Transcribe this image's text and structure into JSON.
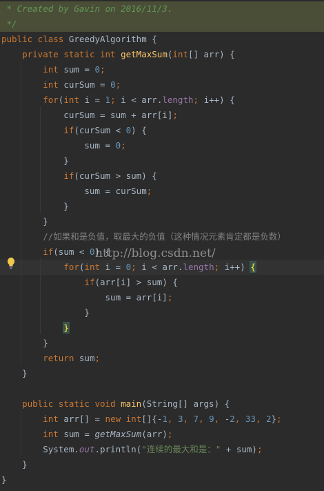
{
  "editor": {
    "lines": [
      [
        [
          "doc",
          " * Created by Gavin on 2016/11/3."
        ]
      ],
      [
        [
          "doc",
          " */"
        ]
      ],
      [
        [
          "kw",
          "public class "
        ],
        [
          "p",
          "GreedyAlgorithm {"
        ]
      ],
      [
        [
          "p",
          "    "
        ],
        [
          "kw",
          "private static int "
        ],
        [
          "fn",
          "getMaxSum"
        ],
        [
          "p",
          "("
        ],
        [
          "kw",
          "int"
        ],
        [
          "p",
          "[] arr) {"
        ]
      ],
      [
        [
          "p",
          "        "
        ],
        [
          "kw",
          "int "
        ],
        [
          "p",
          "sum = "
        ],
        [
          "num",
          "0"
        ],
        [
          "kw",
          ";"
        ]
      ],
      [
        [
          "p",
          "        "
        ],
        [
          "kw",
          "int "
        ],
        [
          "p",
          "curSum = "
        ],
        [
          "num",
          "0"
        ],
        [
          "kw",
          ";"
        ]
      ],
      [
        [
          "p",
          "        "
        ],
        [
          "kw",
          "for"
        ],
        [
          "p",
          "("
        ],
        [
          "kw",
          "int "
        ],
        [
          "p",
          "i = "
        ],
        [
          "num",
          "1"
        ],
        [
          "kw",
          "; "
        ],
        [
          "p",
          "i < arr."
        ],
        [
          "fld",
          "length"
        ],
        [
          "kw",
          "; "
        ],
        [
          "p",
          "i++) {"
        ]
      ],
      [
        [
          "p",
          "            curSum = sum + arr[i]"
        ],
        [
          "kw",
          ";"
        ]
      ],
      [
        [
          "p",
          "            "
        ],
        [
          "kw",
          "if"
        ],
        [
          "p",
          "(curSum < "
        ],
        [
          "num",
          "0"
        ],
        [
          "p",
          ") {"
        ]
      ],
      [
        [
          "p",
          "                sum = "
        ],
        [
          "num",
          "0"
        ],
        [
          "kw",
          ";"
        ]
      ],
      [
        [
          "p",
          "            }"
        ]
      ],
      [
        [
          "p",
          "            "
        ],
        [
          "kw",
          "if"
        ],
        [
          "p",
          "(curSum > sum) {"
        ]
      ],
      [
        [
          "p",
          "                sum = curSum"
        ],
        [
          "kw",
          ";"
        ]
      ],
      [
        [
          "p",
          "            }"
        ]
      ],
      [
        [
          "p",
          "        }"
        ]
      ],
      [
        [
          "p",
          "        "
        ],
        [
          "cm",
          "//如果和是负值，取最大的负值（这种情况元素肯定都是负数）"
        ]
      ],
      [
        [
          "p",
          "        "
        ],
        [
          "kw",
          "if"
        ],
        [
          "p",
          "(sum < "
        ],
        [
          "num",
          "0"
        ],
        [
          "p",
          ") {"
        ]
      ],
      [
        [
          "p",
          "            "
        ],
        [
          "kw",
          "for"
        ],
        [
          "p",
          "("
        ],
        [
          "kw",
          "int "
        ],
        [
          "p",
          "i = "
        ],
        [
          "num",
          "0"
        ],
        [
          "kw",
          "; "
        ],
        [
          "p",
          "i < arr."
        ],
        [
          "fld",
          "length"
        ],
        [
          "kw",
          "; "
        ],
        [
          "p",
          "i++) "
        ],
        [
          "hl",
          "{"
        ]
      ],
      [
        [
          "p",
          "                "
        ],
        [
          "kw",
          "if"
        ],
        [
          "p",
          "(arr[i] > sum) {"
        ]
      ],
      [
        [
          "p",
          "                    sum = arr[i]"
        ],
        [
          "kw",
          ";"
        ]
      ],
      [
        [
          "p",
          "                }"
        ]
      ],
      [
        [
          "p",
          "            "
        ],
        [
          "hl",
          "}"
        ]
      ],
      [
        [
          "p",
          "        }"
        ]
      ],
      [
        [
          "p",
          "        "
        ],
        [
          "kw",
          "return "
        ],
        [
          "p",
          "sum"
        ],
        [
          "kw",
          ";"
        ]
      ],
      [
        [
          "p",
          "    }"
        ]
      ],
      [
        [
          "p",
          ""
        ]
      ],
      [
        [
          "p",
          "    "
        ],
        [
          "kw",
          "public static void "
        ],
        [
          "fn",
          "main"
        ],
        [
          "p",
          "(String[] args) {"
        ]
      ],
      [
        [
          "p",
          "        "
        ],
        [
          "kw",
          "int "
        ],
        [
          "p",
          "arr[] = "
        ],
        [
          "kw",
          "new int"
        ],
        [
          "p",
          "[]{-"
        ],
        [
          "num",
          "1"
        ],
        [
          "kw",
          ", "
        ],
        [
          "num",
          "3"
        ],
        [
          "kw",
          ", "
        ],
        [
          "num",
          "7"
        ],
        [
          "kw",
          ", "
        ],
        [
          "num",
          "9"
        ],
        [
          "kw",
          ", "
        ],
        [
          "p",
          "-"
        ],
        [
          "num",
          "2"
        ],
        [
          "kw",
          ", "
        ],
        [
          "num",
          "33"
        ],
        [
          "kw",
          ", "
        ],
        [
          "num",
          "2"
        ],
        [
          "p",
          "}"
        ],
        [
          "kw",
          ";"
        ]
      ],
      [
        [
          "p",
          "        "
        ],
        [
          "kw",
          "int "
        ],
        [
          "p",
          "sum = "
        ],
        [
          "st",
          "getMaxSum"
        ],
        [
          "p",
          "(arr)"
        ],
        [
          "kw",
          ";"
        ]
      ],
      [
        [
          "p",
          "        System."
        ],
        [
          "fldi",
          "out"
        ],
        [
          "p",
          ".println("
        ],
        [
          "str",
          "\"连续的最大和是：\""
        ],
        [
          "p",
          " + sum)"
        ],
        [
          "kw",
          ";"
        ]
      ],
      [
        [
          "p",
          "    }"
        ]
      ],
      [
        [
          "p",
          "}"
        ]
      ]
    ],
    "watermark": "http://blog.csdn.net/",
    "colors": {
      "background": "#2b2b2b",
      "keyword": "#cc7832",
      "number": "#6897bb",
      "string": "#6a8759",
      "comment": "#808080",
      "doc_comment": "#629755",
      "method": "#ffc66d",
      "field": "#9876aa",
      "plain": "#a9b7c6"
    },
    "icons": {
      "intention": "lightbulb-icon"
    }
  }
}
